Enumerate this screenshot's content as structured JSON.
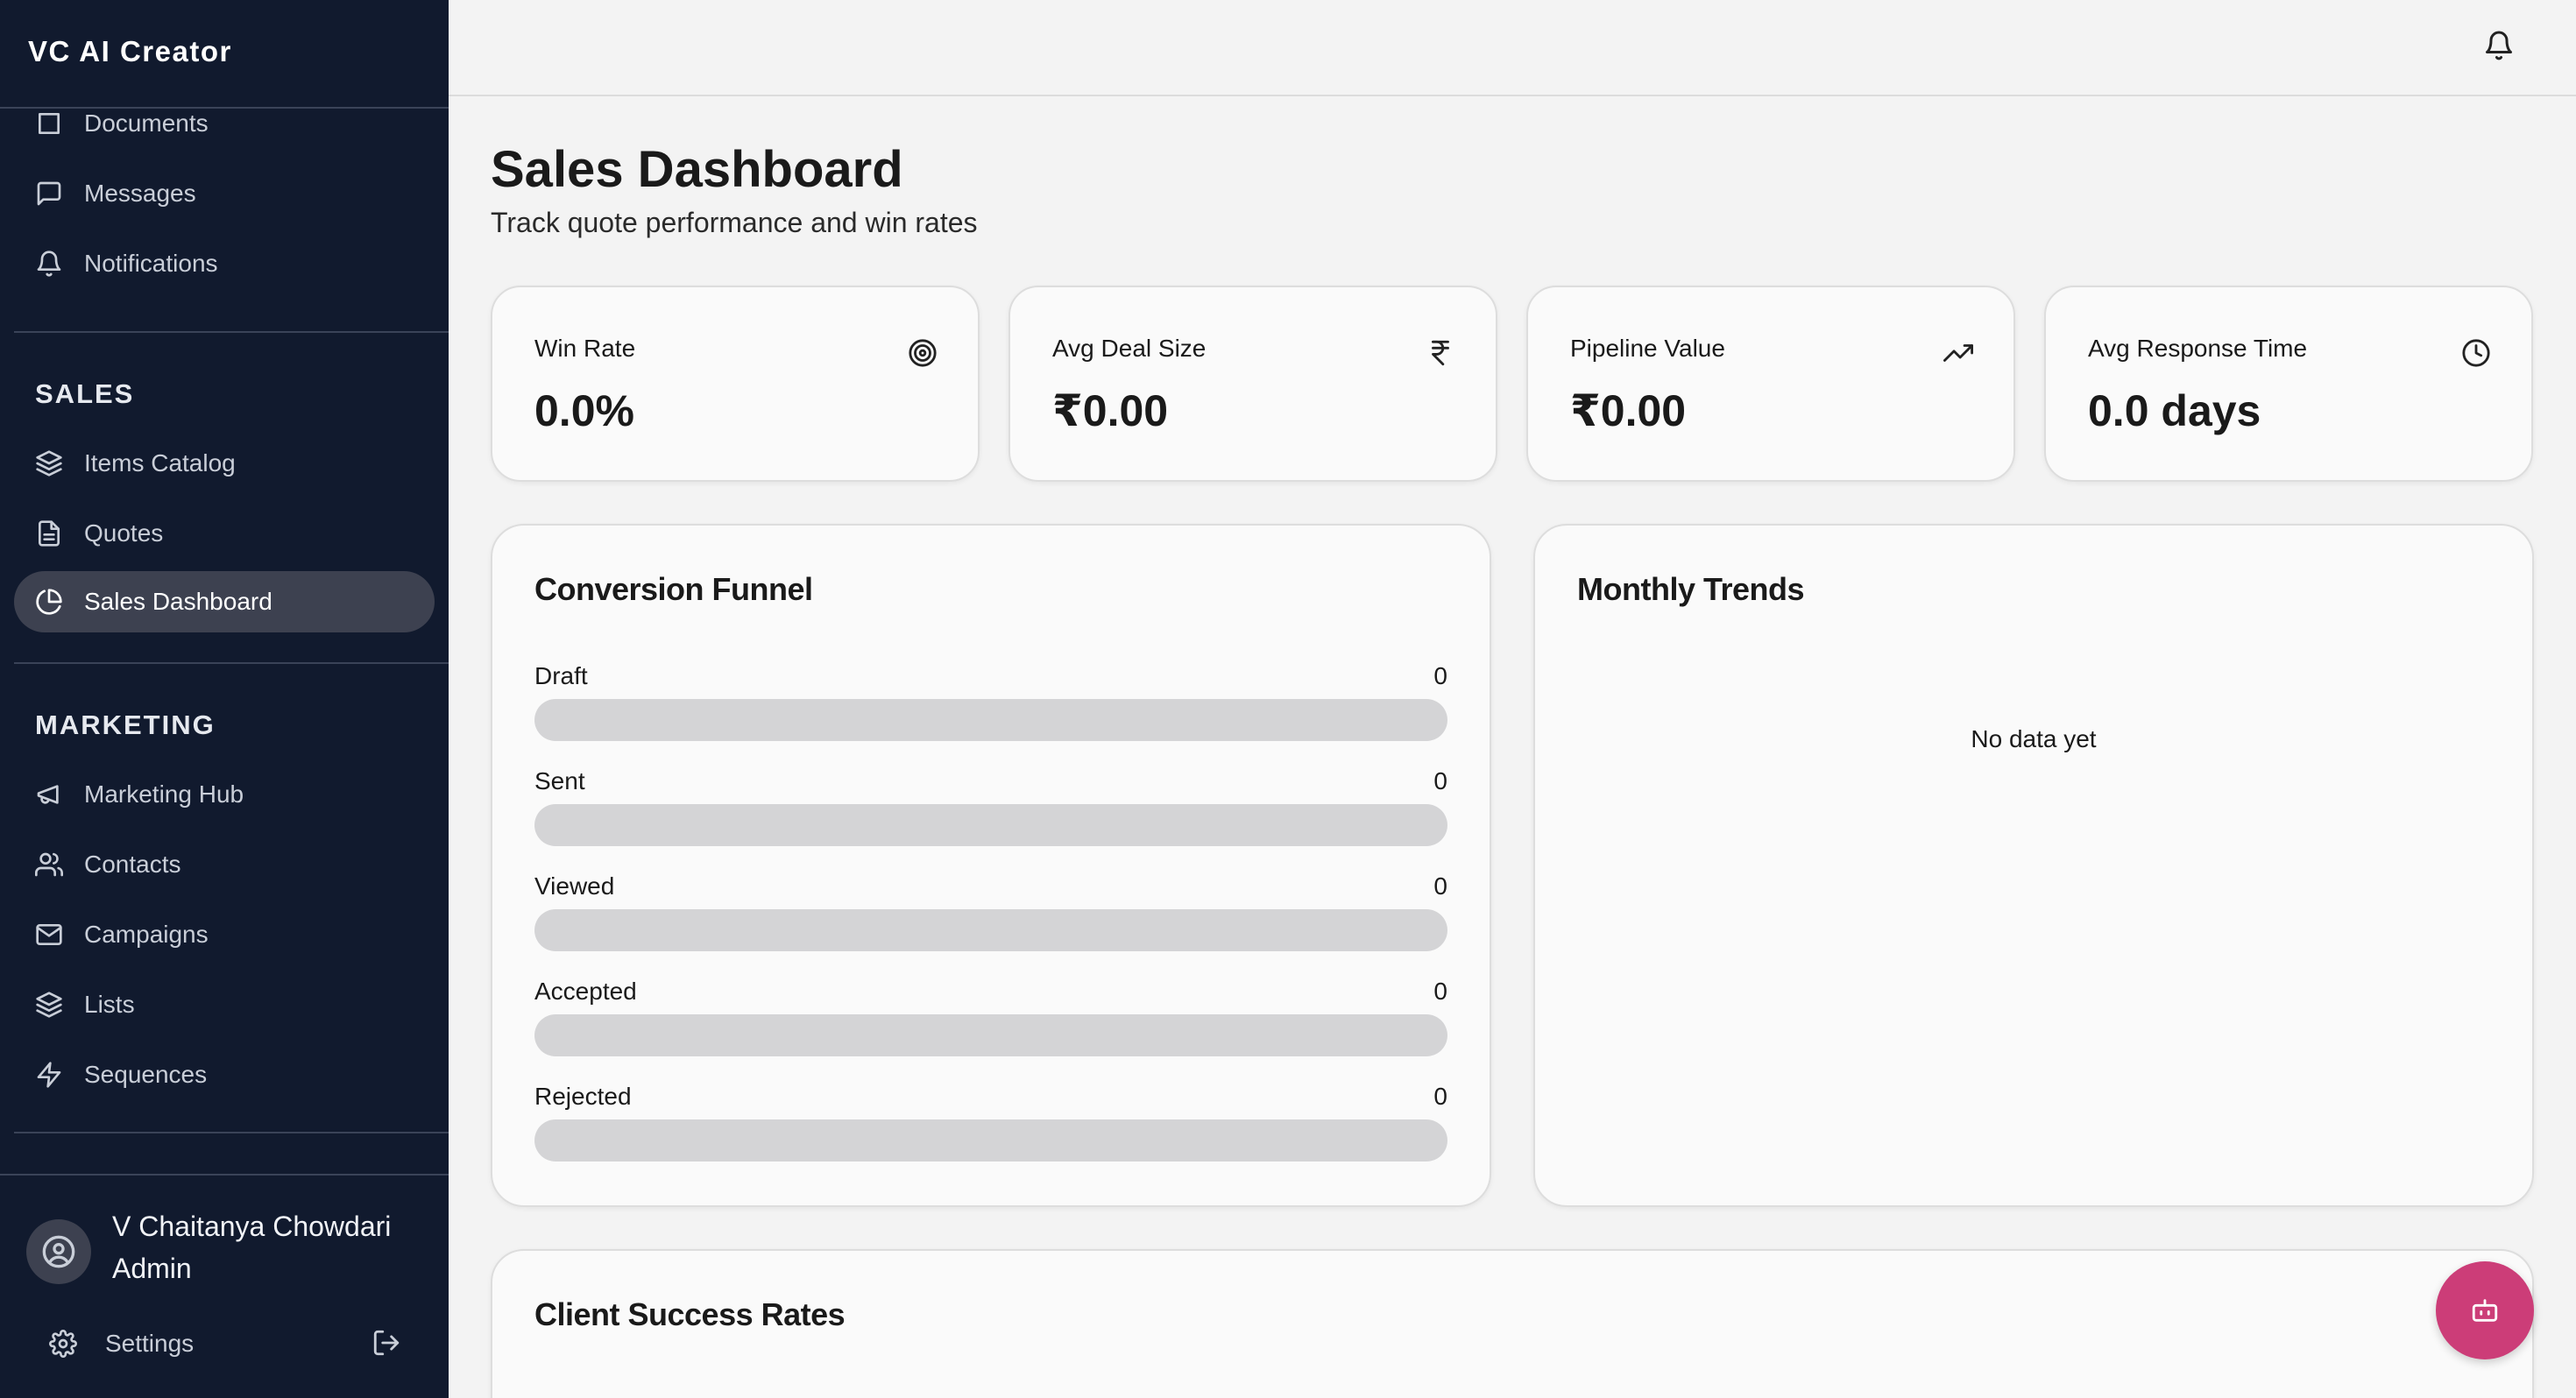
{
  "brand": {
    "title": "VC AI Creator"
  },
  "sidebar": {
    "partial_item": {
      "label": "Documents",
      "icon": "folder-icon"
    },
    "top_items": [
      {
        "label": "Messages",
        "icon": "message-square-icon"
      },
      {
        "label": "Notifications",
        "icon": "bell-icon"
      }
    ],
    "sales": {
      "title": "SALES",
      "items": [
        {
          "label": "Items Catalog",
          "icon": "layers-icon"
        },
        {
          "label": "Quotes",
          "icon": "file-text-icon"
        },
        {
          "label": "Sales Dashboard",
          "icon": "pie-chart-icon",
          "active": true
        }
      ]
    },
    "marketing": {
      "title": "MARKETING",
      "items": [
        {
          "label": "Marketing Hub",
          "icon": "megaphone-icon"
        },
        {
          "label": "Contacts",
          "icon": "users-icon"
        },
        {
          "label": "Campaigns",
          "icon": "mail-icon"
        },
        {
          "label": "Lists",
          "icon": "layers-icon"
        },
        {
          "label": "Sequences",
          "icon": "zap-icon"
        }
      ]
    },
    "user": {
      "name": "V Chaitanya Chowdari",
      "role": "Admin",
      "settings_label": "Settings"
    }
  },
  "header": {
    "notification_icon": "bell-icon"
  },
  "page": {
    "title": "Sales Dashboard",
    "subtitle": "Track quote performance and win rates"
  },
  "stats": [
    {
      "label": "Win Rate",
      "value": "0.0%",
      "icon": "target-icon"
    },
    {
      "label": "Avg Deal Size",
      "value": "₹0.00",
      "icon": "rupee-icon"
    },
    {
      "label": "Pipeline Value",
      "value": "₹0.00",
      "icon": "trending-up-icon"
    },
    {
      "label": "Avg Response Time",
      "value": "0.0 days",
      "icon": "clock-icon"
    }
  ],
  "funnel": {
    "title": "Conversion Funnel",
    "stages": [
      {
        "label": "Draft",
        "count": "0",
        "fraction": 0
      },
      {
        "label": "Sent",
        "count": "0",
        "fraction": 0
      },
      {
        "label": "Viewed",
        "count": "0",
        "fraction": 0
      },
      {
        "label": "Accepted",
        "count": "0",
        "fraction": 0
      },
      {
        "label": "Rejected",
        "count": "0",
        "fraction": 0
      }
    ]
  },
  "trends": {
    "title": "Monthly Trends",
    "empty_text": "No data yet"
  },
  "client_success": {
    "title": "Client Success Rates"
  },
  "assistant": {
    "icon": "bot-icon",
    "color": "#cc3d78"
  },
  "colors": {
    "sidebar_bg": "#111a2e",
    "active_item_bg": "#3d4150",
    "page_bg": "#f3f3f3",
    "accent": "#cc3d78"
  }
}
